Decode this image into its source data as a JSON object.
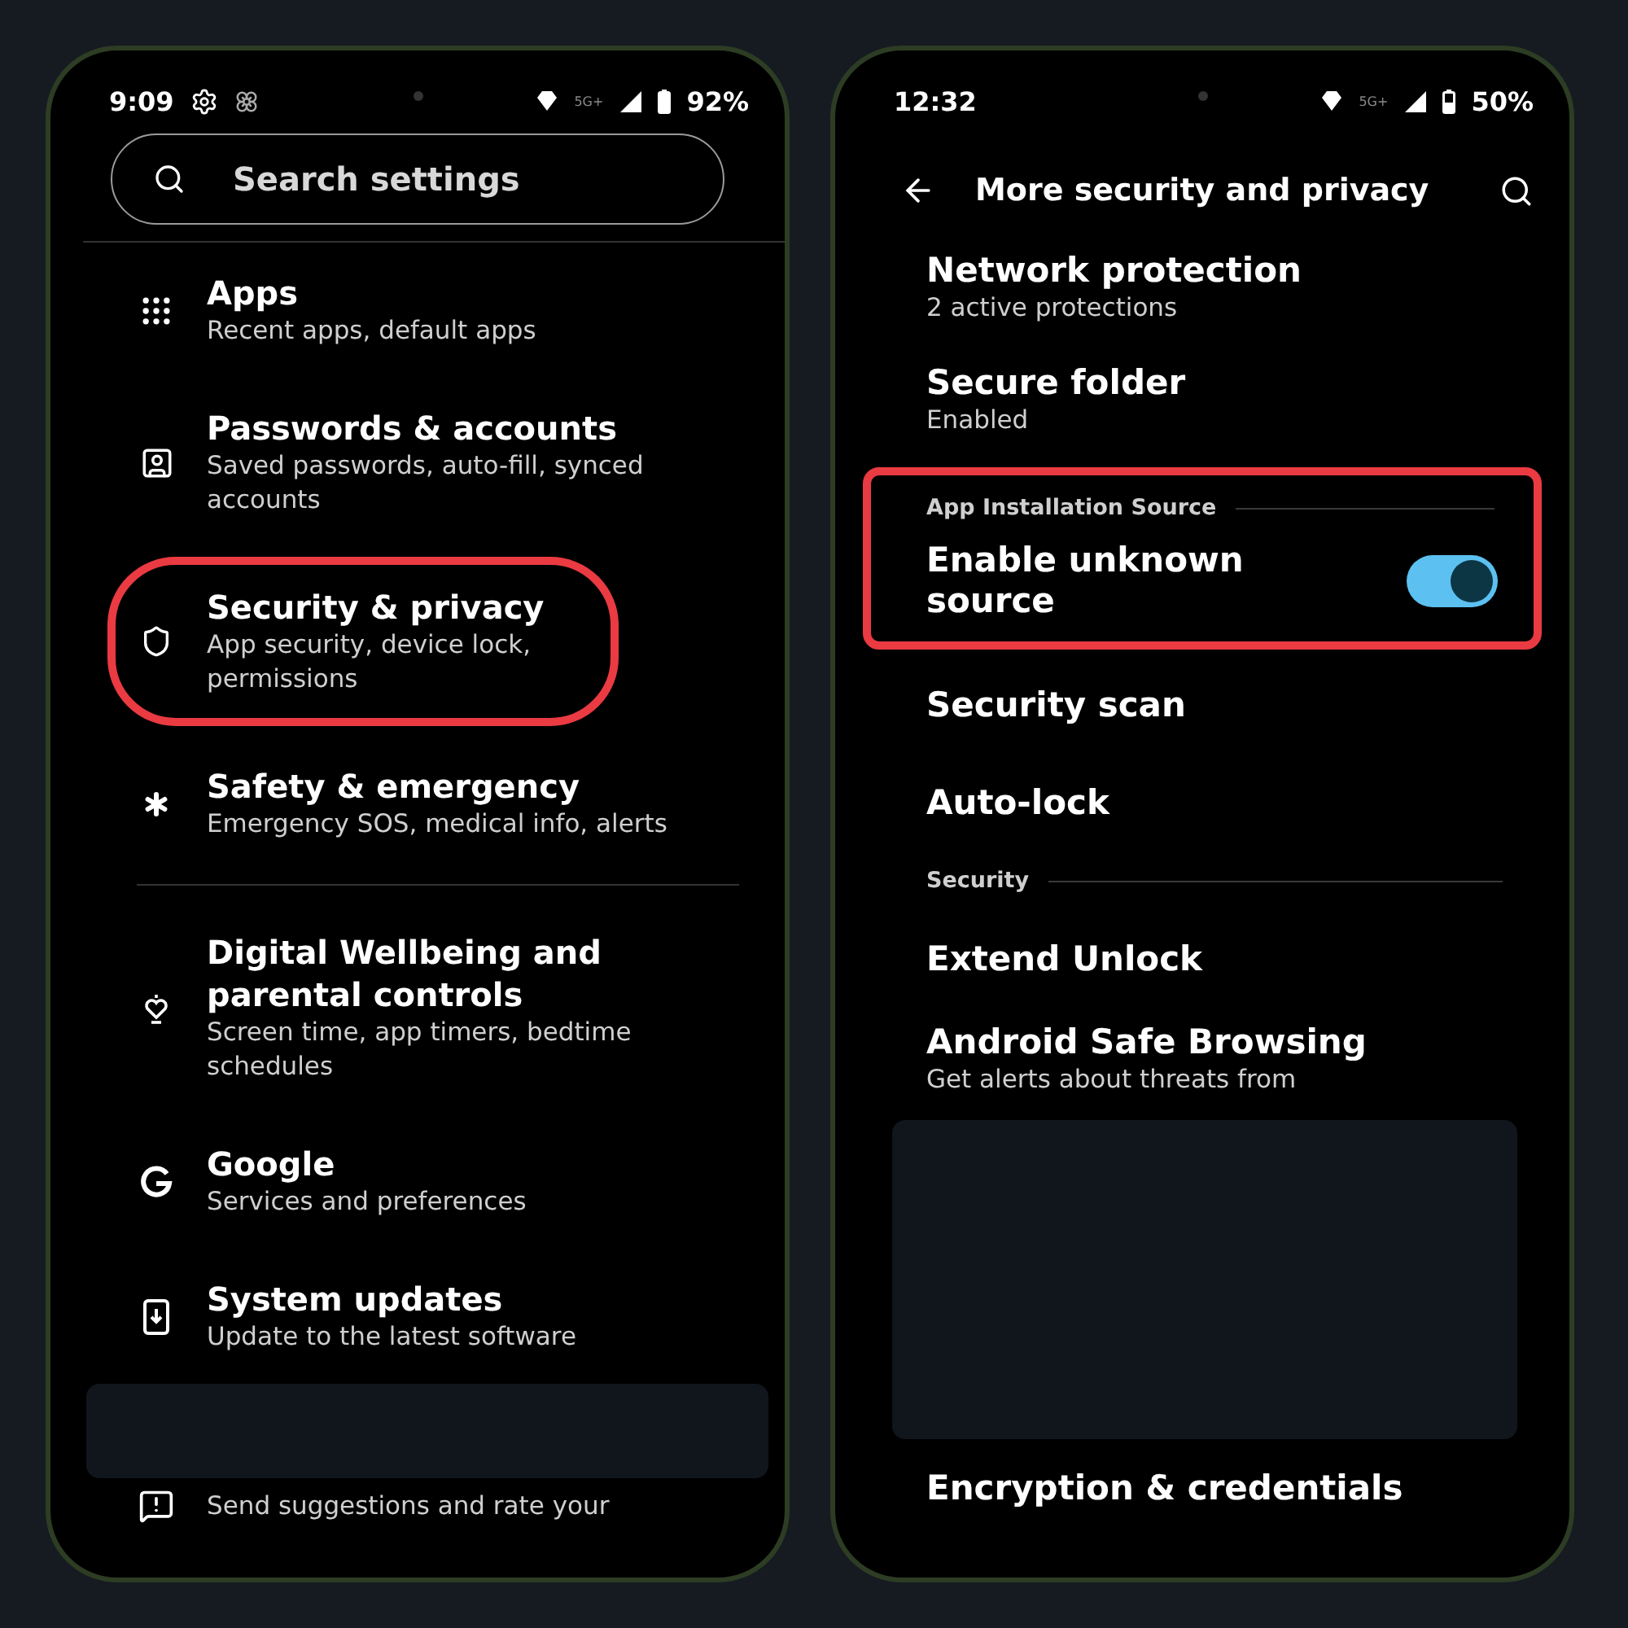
{
  "left_phone": {
    "status_bar": {
      "time": "9:09",
      "network": "5G+",
      "battery": "92%"
    },
    "search": {
      "placeholder": "Search settings"
    },
    "items": [
      {
        "kind": "item",
        "title": "Apps",
        "subtitle": "Recent apps, default apps",
        "highlighted": false
      },
      {
        "kind": "item",
        "title": "Passwords & accounts",
        "subtitle": "Saved passwords, auto-fill, synced accounts",
        "highlighted": false
      },
      {
        "kind": "item",
        "title": "Security & privacy",
        "subtitle": "App security, device lock, permissions",
        "highlighted": true
      },
      {
        "kind": "item",
        "title": "Safety & emergency",
        "subtitle": "Emergency SOS, medical info, alerts",
        "highlighted": false
      },
      {
        "kind": "divider"
      },
      {
        "kind": "item",
        "title": "Digital Wellbeing and parental controls",
        "subtitle": "Screen time, app timers, bedtime schedules",
        "highlighted": false
      },
      {
        "kind": "item",
        "title": "Google",
        "subtitle": "Services and preferences",
        "highlighted": false
      },
      {
        "kind": "item",
        "title": "System updates",
        "subtitle": "Update to the latest software",
        "highlighted": false
      },
      {
        "kind": "cover"
      },
      {
        "kind": "item",
        "subtitle": "Send suggestions and rate your",
        "highlighted": false
      }
    ]
  },
  "right_phone": {
    "status_bar": {
      "time": "12:32",
      "network": "5G+",
      "battery": "50%"
    },
    "header": {
      "title": "More security and privacy"
    },
    "items": [
      {
        "kind": "item",
        "title": "Network protection",
        "subtitle": "2 active protections"
      },
      {
        "kind": "item",
        "title": "Secure folder",
        "subtitle": "Enabled"
      },
      {
        "kind": "highlight",
        "items": [
          {
            "kind": "section",
            "title": "App Installation Source"
          },
          {
            "kind": "toggle",
            "title": "Enable unknown source",
            "on": true
          }
        ]
      },
      {
        "kind": "item",
        "title": "Security scan"
      },
      {
        "kind": "item",
        "title": "Auto-lock"
      },
      {
        "kind": "section",
        "title": "Security"
      },
      {
        "kind": "item",
        "title": "Extend Unlock"
      },
      {
        "kind": "item",
        "title": "Android Safe Browsing",
        "subtitle": "Get alerts about threats from"
      },
      {
        "kind": "cover"
      },
      {
        "kind": "item",
        "title": "Encryption & credentials"
      }
    ]
  }
}
